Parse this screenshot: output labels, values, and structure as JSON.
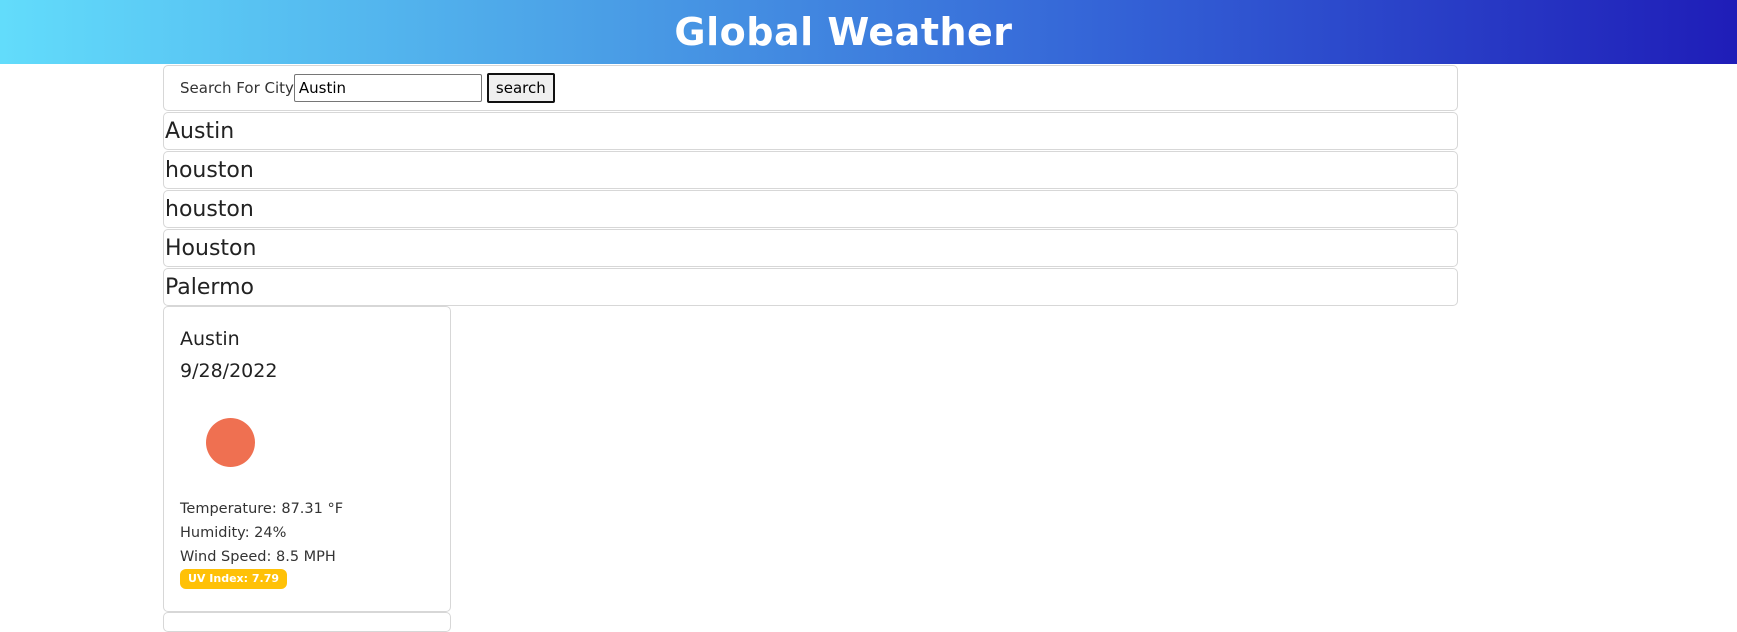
{
  "header": {
    "title": "Global Weather"
  },
  "search": {
    "label": "Search For City",
    "value": "Austin",
    "button_label": "search"
  },
  "history": [
    {
      "label": "Austin"
    },
    {
      "label": "houston"
    },
    {
      "label": "houston"
    },
    {
      "label": "Houston"
    },
    {
      "label": "Palermo"
    }
  ],
  "current": {
    "city": "Austin",
    "date": "9/28/2022",
    "icon": "sun-icon",
    "icon_color": "#ef7051",
    "temperature": "Temperature: 87.31 °F",
    "humidity": "Humidity: 24%",
    "wind": "Wind Speed: 8.5 MPH",
    "uv": "UV Index: 7.79",
    "uv_color": "#ffc107"
  },
  "colors": {
    "header_gradient_start": "#62dcfb",
    "header_gradient_end": "#1f1db8"
  }
}
